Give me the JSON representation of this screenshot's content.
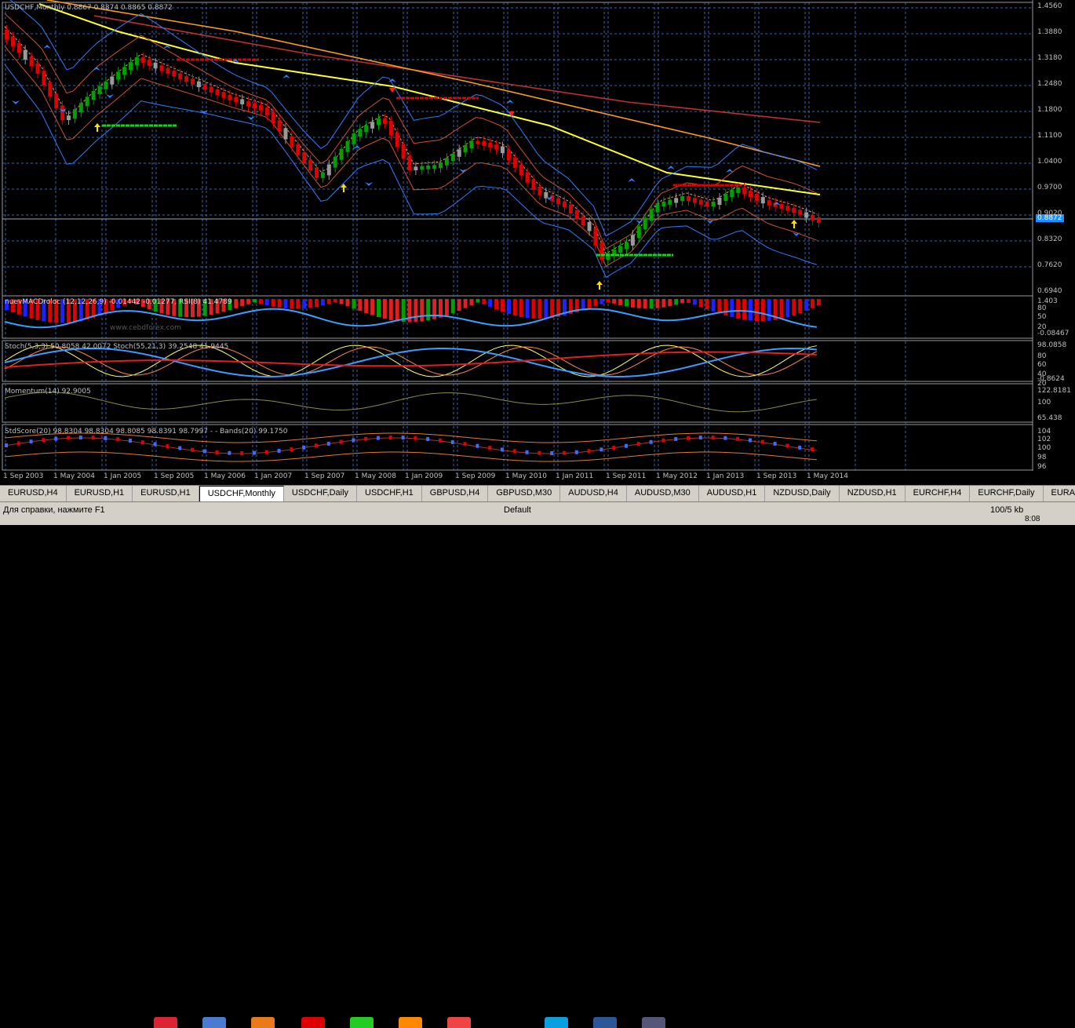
{
  "window": {
    "title": "USDCHF,Monthly",
    "ohlc": "0.8867 0.8874 0.8865 0.8872"
  },
  "price_axis": [
    "1.4560",
    "1.3880",
    "1.3180",
    "1.2480",
    "1.1800",
    "1.1100",
    "1.0400",
    "0.9700",
    "0.9020",
    "0.8320",
    "0.7620",
    "0.6940"
  ],
  "current_price": "0.8872",
  "indicators": {
    "macd": "nuevMACDroloc (12,12,26,9) -0.01442 -0.01277, RSI(8) 41.4789",
    "macd_axis": [
      "1.403",
      "80",
      "50",
      "20",
      "-0.08467"
    ],
    "stoch": "Stoch(5,3,3) 50.8058 42.0072 Stoch(55,21,3) 39.2548 41.9445",
    "stoch_axis": [
      "98.0858",
      "80",
      "60",
      "40",
      "20",
      "-0.8624"
    ],
    "momentum": "Momentum(14) 92.9005",
    "momentum_axis": [
      "122.8181",
      "100",
      "65.438"
    ],
    "stdscore": "StdScore(20) 98.8304 98.8304 98.8085 98.8391 98.7997 - - Bands(20) 99.1750",
    "stdscore_axis": [
      "104",
      "102",
      "100",
      "98",
      "96"
    ],
    "watermark": "www.cebdforex.com"
  },
  "time_axis": [
    "1 Sep 2003",
    "1 May 2004",
    "1 Jan 2005",
    "1 Sep 2005",
    "1 May 2006",
    "1 Jan 2007",
    "1 Sep 2007",
    "1 May 2008",
    "1 Jan 2009",
    "1 Sep 2009",
    "1 May 2010",
    "1 Jan 2011",
    "1 Sep 2011",
    "1 May 2012",
    "1 Jan 2013",
    "1 Sep 2013",
    "1 May 2014"
  ],
  "tabs": [
    {
      "label": "EURUSD,H4",
      "active": false
    },
    {
      "label": "EURUSD,H1",
      "active": false
    },
    {
      "label": "EURUSD,H1",
      "active": false
    },
    {
      "label": "USDCHF,Monthly",
      "active": true
    },
    {
      "label": "USDCHF,Daily",
      "active": false
    },
    {
      "label": "USDCHF,H1",
      "active": false
    },
    {
      "label": "GBPUSD,H4",
      "active": false
    },
    {
      "label": "GBPUSD,M30",
      "active": false
    },
    {
      "label": "AUDUSD,H4",
      "active": false
    },
    {
      "label": "AUDUSD,M30",
      "active": false
    },
    {
      "label": "AUDUSD,H1",
      "active": false
    },
    {
      "label": "NZDUSD,Daily",
      "active": false
    },
    {
      "label": "NZDUSD,H1",
      "active": false
    },
    {
      "label": "EURCHF,H4",
      "active": false
    },
    {
      "label": "EURCHF,Daily",
      "active": false
    },
    {
      "label": "EURAUD,H",
      "active": false
    }
  ],
  "status": {
    "help": "Для справки, нажмите F1",
    "profile": "Default",
    "traffic": "100/5 kb",
    "clock": "8:08"
  },
  "colors": {
    "bg": "#000000",
    "grid": "#1e6bd6",
    "bull": "#00a000",
    "bear": "#e00000",
    "neutral": "#9a9a9a",
    "ema_yellow": "#ffff33",
    "ema_orange": "#ff9a20",
    "ema_red": "#c03030",
    "band_blue": "#2f7dff"
  }
}
